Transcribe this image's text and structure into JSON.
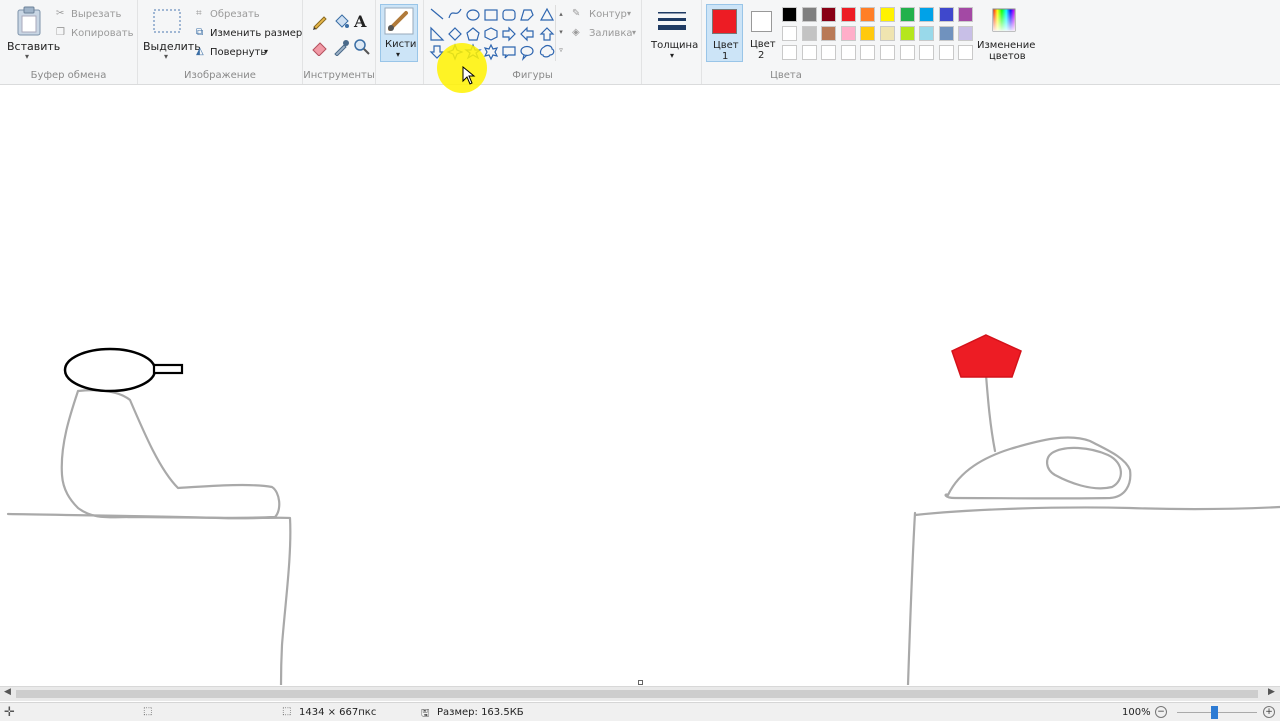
{
  "clipboard": {
    "paste": "Вставить",
    "cut": "Вырезать",
    "copy": "Копировать",
    "label": "Буфер обмена"
  },
  "image": {
    "select": "Выделить",
    "crop": "Обрезать",
    "resize": "Изменить размер",
    "rotate": "Повернуть",
    "label": "Изображение"
  },
  "tools": {
    "label": "Инструменты",
    "text_glyph": "A"
  },
  "brushes": {
    "label": "Кисти"
  },
  "shapes": {
    "outline": "Контур",
    "fill": "Заливка",
    "label": "Фигуры"
  },
  "size": {
    "label": "Толщина"
  },
  "colors": {
    "color1_label": "Цвет",
    "color1_num": "1",
    "color1_value": "#ed1c24",
    "color2_label": "Цвет",
    "color2_num": "2",
    "color2_value": "#ffffff",
    "edit_line1": "Изменение",
    "edit_line2": "цветов",
    "label": "Цвета",
    "palette_row1": [
      "#000000",
      "#7f7f7f",
      "#880015",
      "#ed1c24",
      "#ff7f27",
      "#fff200",
      "#22b14c",
      "#00a2e8",
      "#3f48cc",
      "#a349a4"
    ],
    "palette_row2": [
      "#ffffff",
      "#c3c3c3",
      "#b97a57",
      "#ffaec9",
      "#ffc90e",
      "#efe4b0",
      "#b5e61d",
      "#99d9ea",
      "#7092be",
      "#c8bfe7"
    ]
  },
  "status": {
    "dimensions": "1434 × 667пкс",
    "file_size": "Размер: 163.5КБ",
    "zoom": "100%"
  }
}
